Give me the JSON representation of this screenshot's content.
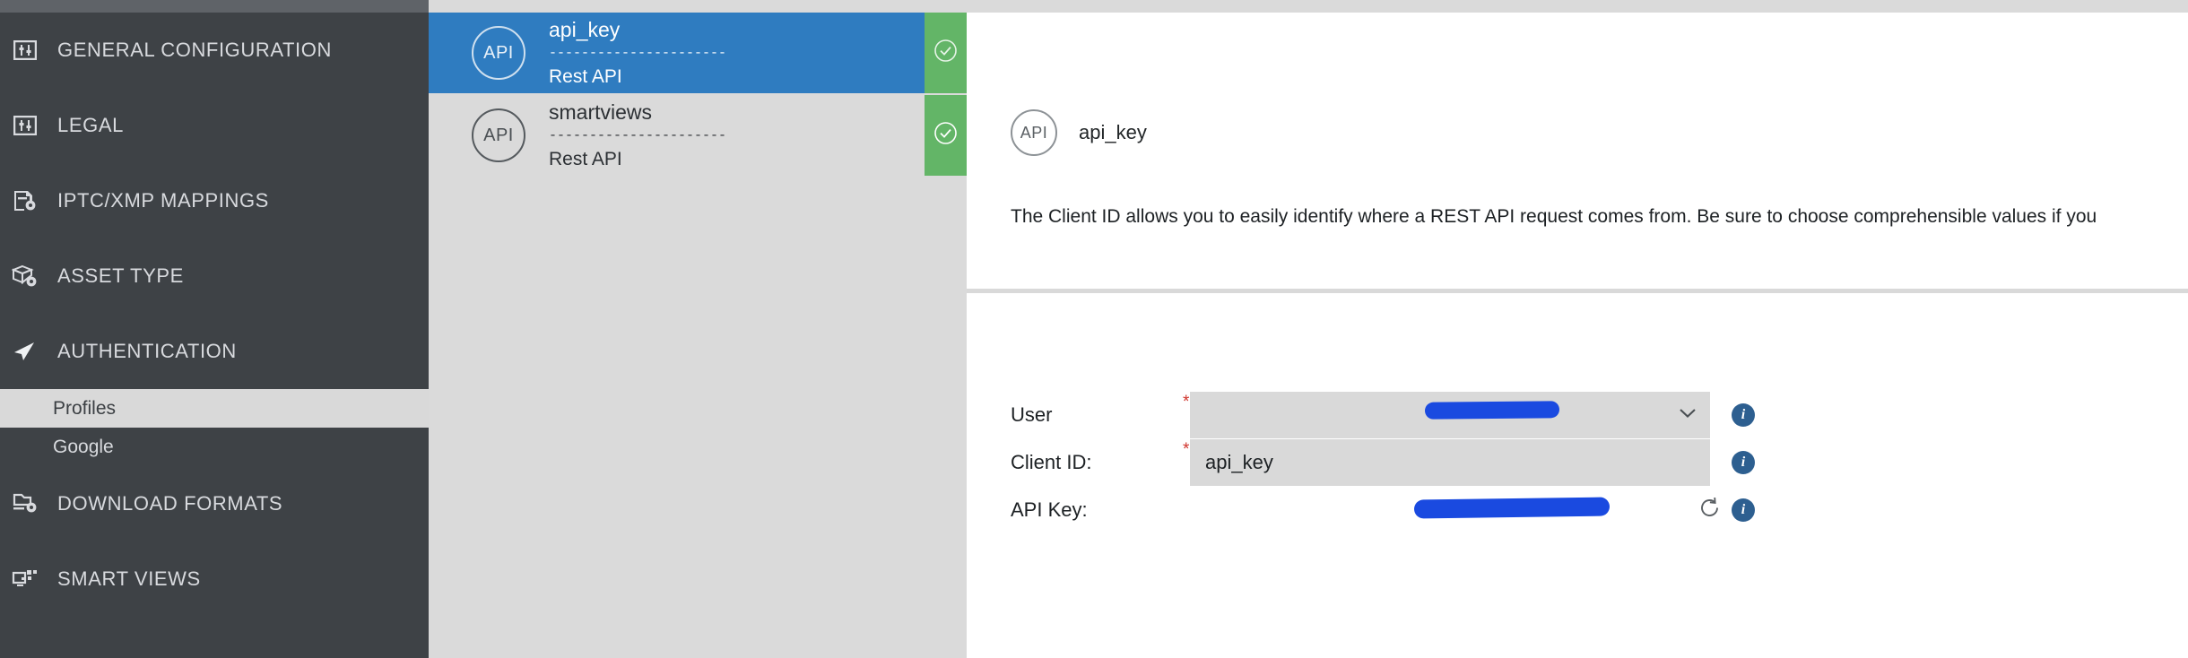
{
  "sidebar": {
    "items": [
      {
        "label": "GENERAL CONFIGURATION",
        "icon": "sliders-box-icon"
      },
      {
        "label": "LEGAL",
        "icon": "sliders-box-icon"
      },
      {
        "label": "IPTC/XMP MAPPINGS",
        "icon": "document-gear-icon"
      },
      {
        "label": "ASSET TYPE",
        "icon": "box-gear-icon"
      },
      {
        "label": "AUTHENTICATION",
        "icon": "paper-plane-icon"
      },
      {
        "label": "DOWNLOAD FORMATS",
        "icon": "file-download-gear-icon"
      },
      {
        "label": "SMART VIEWS",
        "icon": "monitor-tiles-icon"
      }
    ],
    "sub_items": [
      {
        "label": "Profiles",
        "active": true
      },
      {
        "label": "Google",
        "active": false
      }
    ]
  },
  "list_panel": {
    "rows": [
      {
        "avatar": "API",
        "title": "api_key",
        "separator": "------------------------------------------",
        "subtitle": "Rest API",
        "selected": true,
        "status_icon": "check-circle-icon"
      },
      {
        "avatar": "API",
        "title": "smartviews",
        "separator": "------------------------------------------",
        "subtitle": "Rest API",
        "selected": false,
        "status_icon": "check-circle-icon"
      }
    ]
  },
  "main": {
    "header": {
      "avatar": "API",
      "title": "api_key"
    },
    "description": "The Client ID allows you to easily identify where a REST API request comes from. Be sure to choose comprehensible values if you",
    "fields": [
      {
        "label": "User",
        "required": true,
        "value": "",
        "redacted": true,
        "control": "dropdown",
        "info_label": "i"
      },
      {
        "label": "Client ID:",
        "required": true,
        "value": "api_key",
        "redacted": false,
        "control": "text",
        "info_label": "i"
      },
      {
        "label": "API Key:",
        "required": false,
        "value": "",
        "redacted": true,
        "control": "readonly",
        "info_label": "i"
      }
    ]
  },
  "colors": {
    "sidebar_bg": "#3e4246",
    "sidebar_top": "#5f6368",
    "list_bg": "#dadada",
    "selected_row": "#2f7cc0",
    "status_green": "#63b567",
    "field_bg": "#d9d9d9",
    "info_blue": "#2d5f90",
    "required_red": "#d0342c",
    "redaction_blue": "#1a4ae0"
  }
}
